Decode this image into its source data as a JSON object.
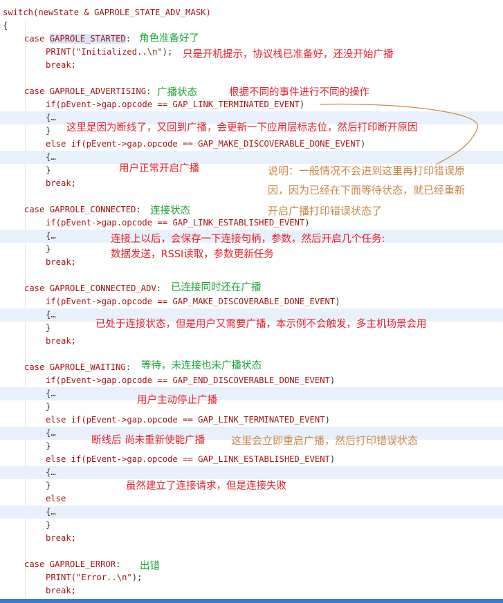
{
  "code": {
    "l1": "switch(newState & GAPROLE_STATE_ADV_MASK)",
    "l2": "{",
    "l3_kw": "case",
    "l3_mac": "GAPROLE_STARTED",
    "l3_p": ":",
    "l4_a": "PRINT(",
    "l4_s": "\"Initialized..\\n\"",
    "l4_b": ");",
    "l5": "break;",
    "l6_kw": "case",
    "l6_mac": "GAPROLE_ADVERTISING",
    "l6_p": ":",
    "l7_a": "if(pEvent->gap.opcode == ",
    "l7_m": "GAP_LINK_TERMINATED_EVENT",
    "l7_b": ")",
    "fold": "{…",
    "close": "}",
    "l10_a": "else if(pEvent->gap.opcode == ",
    "l10_m": "GAP_MAKE_DISCOVERABLE_DONE_EVENT",
    "l10_b": ")",
    "l14_kw": "case",
    "l14_mac": "GAPROLE_CONNECTED",
    "l14_p": ":",
    "l15_a": "if(pEvent->gap.opcode == ",
    "l15_m": "GAP_LINK_ESTABLISHED_EVENT",
    "l15_b": ")",
    "l19_kw": "case",
    "l19_mac": "GAPROLE_CONNECTED_ADV",
    "l19_p": ":",
    "l20_a": "if(pEvent->gap.opcode == ",
    "l20_m": "GAP_MAKE_DISCOVERABLE_DONE_EVENT",
    "l20_b": ")",
    "l24_kw": "case",
    "l24_mac": "GAPROLE_WAITING",
    "l24_p": ":",
    "l25_a": "if(pEvent->gap.opcode == ",
    "l25_m": "GAP_END_DISCOVERABLE_DONE_EVENT",
    "l25_b": ")",
    "l28_a": "else if(pEvent->gap.opcode == ",
    "l28_m": "GAP_LINK_TERMINATED_EVENT",
    "l28_b": ")",
    "l31_a": "else if(pEvent->gap.opcode == ",
    "l31_m": "GAP_LINK_ESTABLISHED_EVENT",
    "l31_b": ")",
    "else": "else",
    "l39_kw": "case",
    "l39_mac": "GAPROLE_ERROR",
    "l39_p": ":",
    "l40_a": "PRINT(",
    "l40_s": "\"Error..\\n\"",
    "l40_b": ");"
  },
  "notes": {
    "n1": "角色准备好了",
    "n2": "只是开机提示，协议栈已准备好，还没开始广播",
    "n3": "广播状态",
    "n4": "根据不同的事件进行不同的操作",
    "n5": "这里是因为断线了，又回到广播，会更新一下应用层标志位，然后打印断开原因",
    "n6": "用户正常开启广播",
    "n7a": "说明：一般情况不会进到这里再打印错误原",
    "n7b": "因，因为已经在下面等待状态，就已经重新",
    "n7c": "开启广播打印错误状态了",
    "n8": "连接状态",
    "n9a": "连接上以后，会保存一下连接句柄，参数，然后开启几个任务:",
    "n9b": "数据发送，RSSI读取，参数更新任务",
    "n10": "已连接同时还在广播",
    "n11": "已处于连接状态，但是用户又需要广播，本示例不会触发，多主机场景会用",
    "n12": "等待，未连接也未广播状态",
    "n13": "用户主动停止广播",
    "n14": "断线后 尚未重新使能广播",
    "n15": "这里会立即重启广播，然后打印错误状态",
    "n16": "虽然建立了连接请求，但是连接失败",
    "n17": "出错"
  },
  "colors": {
    "keyword": "#a31515",
    "note_green": "#22a33b",
    "note_red": "#e8212b",
    "note_orange": "#c98a4a",
    "highlight": "#e8f1fb"
  }
}
